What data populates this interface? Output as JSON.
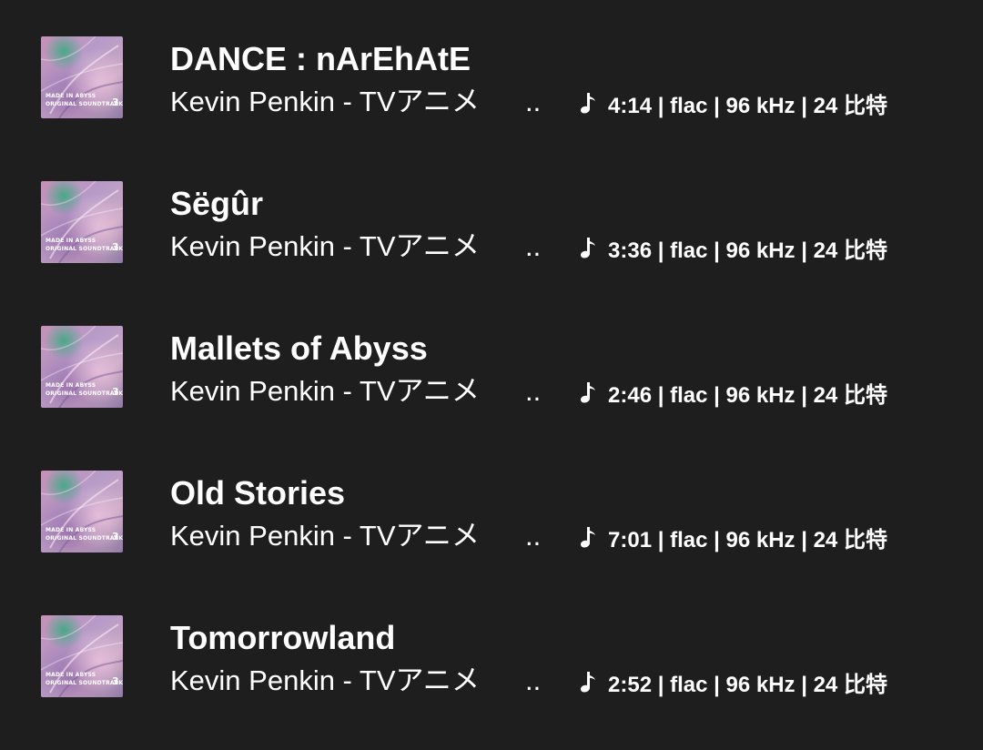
{
  "colors": {
    "background": "#1e1e1e",
    "text": "#ffffff"
  },
  "icons": {
    "cover": "album-cover",
    "format": "music-note-icon"
  },
  "cover_text": {
    "title": "MADE IN ABYSS\nORIGINAL SOUNDTRACK",
    "volume": "3"
  },
  "tracks": [
    {
      "title": "DANCE : nArEhAtE",
      "artist": "Kevin Penkin - TVアニメ",
      "ellipsis": "...",
      "meta": "4:14 | flac | 96 kHz | 24 比特"
    },
    {
      "title": "Sëgûr",
      "artist": "Kevin Penkin - TVアニメ",
      "ellipsis": "...",
      "meta": "3:36 | flac | 96 kHz | 24 比特"
    },
    {
      "title": "Mallets of Abyss",
      "artist": "Kevin Penkin - TVアニメ",
      "ellipsis": "...",
      "meta": "2:46 | flac | 96 kHz | 24 比特"
    },
    {
      "title": "Old Stories",
      "artist": "Kevin Penkin - TVアニメ",
      "ellipsis": "...",
      "meta": "7:01 | flac | 96 kHz | 24 比特"
    },
    {
      "title": "Tomorrowland",
      "artist": "Kevin Penkin - TVアニメ",
      "ellipsis": "...",
      "meta": "2:52 | flac | 96 kHz | 24 比特"
    }
  ]
}
